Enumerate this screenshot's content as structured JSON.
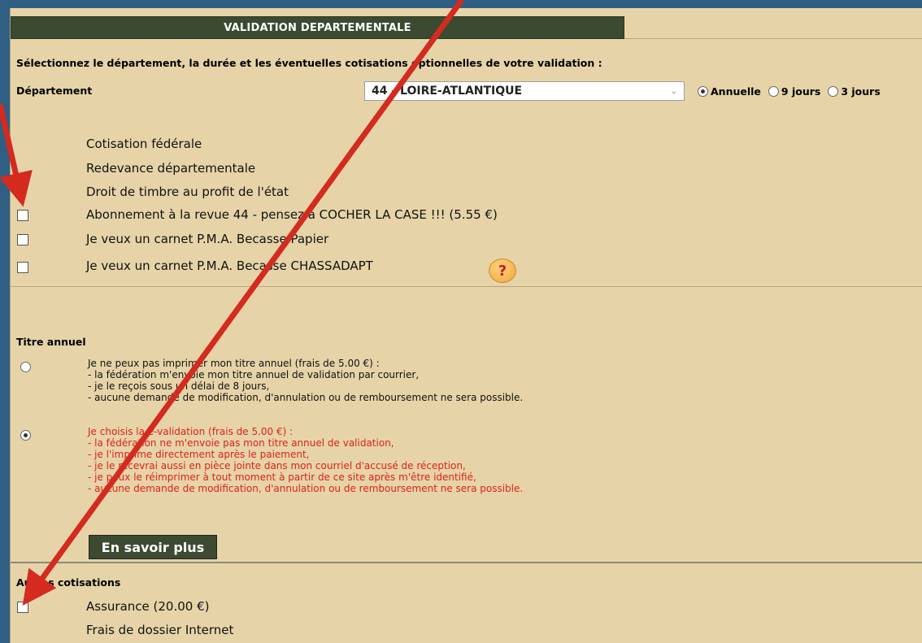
{
  "header": {
    "tab_title": "VALIDATION DEPARTEMENTALE"
  },
  "intro": "Sélectionnez le département, la durée et les éventuelles cotisations optionnelles de votre validation :",
  "department": {
    "label": "Département",
    "selected": "44 - LOIRE-ATLANTIQUE",
    "durations": [
      {
        "label": "Annuelle",
        "checked": true
      },
      {
        "label": "9 jours",
        "checked": false
      },
      {
        "label": "3 jours",
        "checked": false
      }
    ]
  },
  "fees": [
    {
      "label": "Cotisation fédérale"
    },
    {
      "label": "Redevance départementale"
    },
    {
      "label": "Droit de timbre au profit de l'état"
    },
    {
      "label": "Abonnement à la revue 44 - pensez à COCHER LA CASE !!! (5.55 €)",
      "checked": false
    },
    {
      "label": "Je veux un carnet P.M.A. Becasse Papier",
      "checked": false
    },
    {
      "label": "Je veux un carnet P.M.A. Becasse CHASSADAPT",
      "checked": false
    }
  ],
  "help_icon": "question-bubble-icon",
  "titre_annuel": {
    "title": "Titre annuel",
    "option1": {
      "checked": false,
      "lines": [
        "Je ne peux pas imprimer mon titre annuel (frais de 5.00 €) :",
        "- la fédération m'envoie mon titre annuel de validation par courrier,",
        "- je le reçois sous un délai de 8 jours,",
        "- aucune demande de modification, d'annulation ou de remboursement ne sera possible."
      ]
    },
    "option2": {
      "checked": true,
      "lines": [
        "Je choisis la e-validation (frais de 5.00 €) :",
        "- la fédération ne m'envoie pas mon titre annuel de validation,",
        "- je l'imprime directement après le paiement,",
        "- je le recevrai aussi en pièce jointe dans mon courriel d'accusé de réception,",
        "- je peux le réimprimer à tout moment à partir de ce site après m'être identifié,",
        "- aucune demande de modification, d'annulation ou de remboursement ne sera possible."
      ]
    },
    "more_button": "En savoir plus"
  },
  "autres": {
    "title": "Autres cotisations",
    "items": [
      {
        "label": "Assurance (20.00 €)",
        "checked": false
      },
      {
        "label": "Frais de dossier Internet"
      }
    ]
  },
  "colors": {
    "background": "#e6d4a8",
    "header": "#3c4a32",
    "arrow": "#d32b1f",
    "warning_text": "#e0201a"
  }
}
